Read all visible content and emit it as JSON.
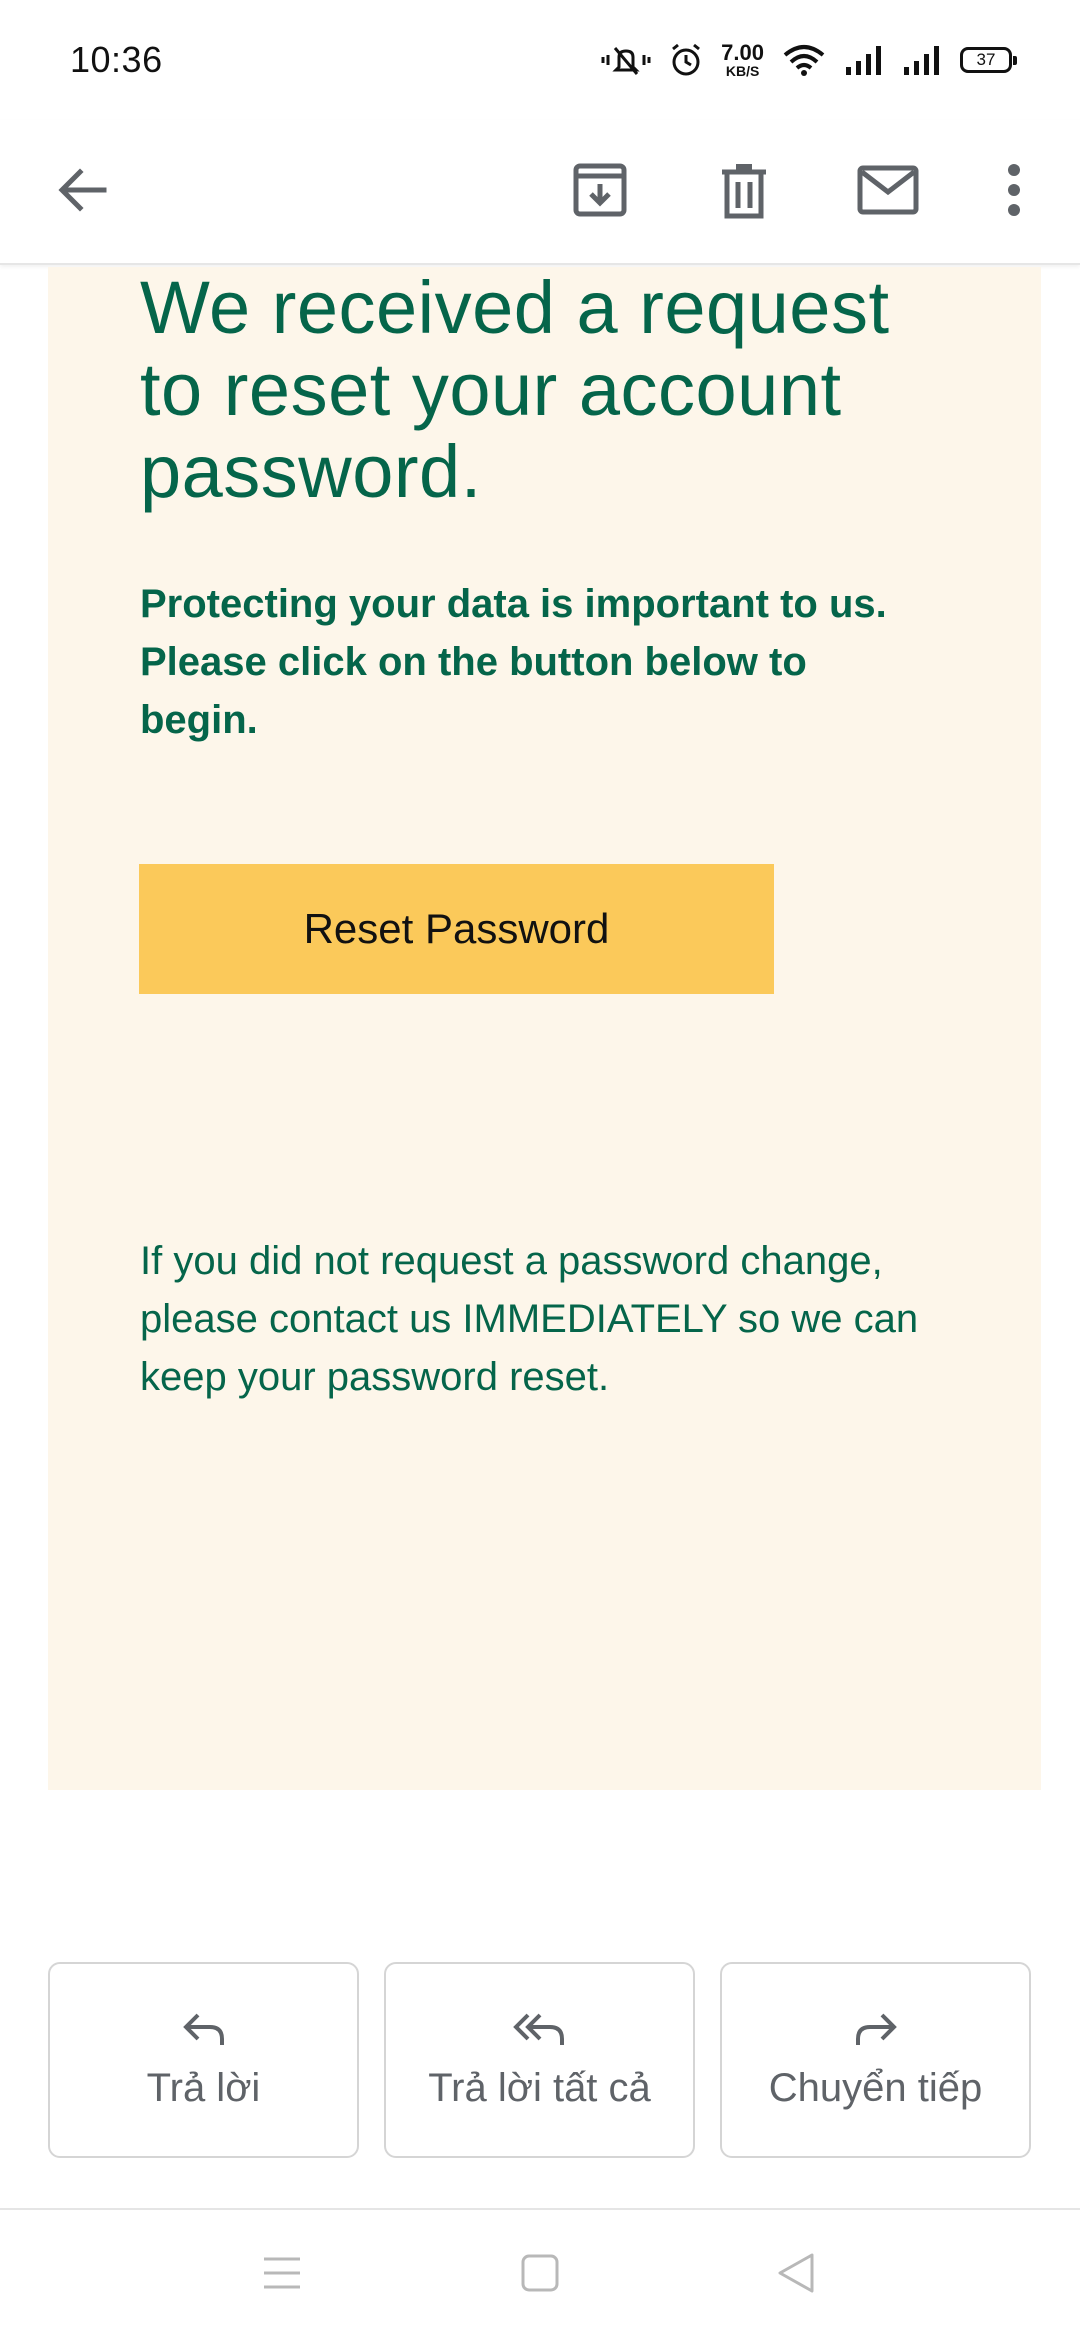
{
  "status_bar": {
    "time": "10:36",
    "net_speed_value": "7.00",
    "net_speed_unit": "KB/S",
    "battery": "37"
  },
  "toolbar": {
    "back_icon": "arrow-left-icon",
    "archive_icon": "archive-icon",
    "delete_icon": "trash-icon",
    "mark_unread_icon": "mail-icon",
    "more_icon": "more-vert-icon"
  },
  "email": {
    "headline": "We received a request to reset your account password.",
    "sub_line1": "Protecting your data is important to us.",
    "sub_line2": "Please click on the button below to begin.",
    "reset_button": "Reset Password",
    "notice": "If you did not request a password change, please contact us IMMEDIATELY so we can keep your password reset."
  },
  "actions": {
    "reply": "Trả lời",
    "reply_all": "Trả lời tất cả",
    "forward": "Chuyển tiếp"
  },
  "colors": {
    "accent_green": "#05654a",
    "card_bg": "#fdf6ea",
    "button_yellow": "#fbc95a"
  }
}
